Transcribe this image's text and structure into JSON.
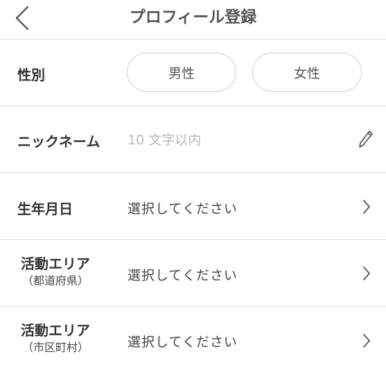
{
  "header": {
    "title": "プロフィール登録",
    "back_icon": "chevron-left-icon"
  },
  "gender": {
    "label": "性別",
    "options": [
      "男性",
      "女性"
    ]
  },
  "nickname": {
    "label": "ニックネーム",
    "placeholder": "10 文字以内",
    "value": "",
    "edit_icon": "pencil-icon"
  },
  "birthday": {
    "label": "生年月日",
    "value": "選択してください"
  },
  "area_prefecture": {
    "label": "活動エリア",
    "sublabel": "（都道府県）",
    "value": "選択してください"
  },
  "area_city": {
    "label": "活動エリア",
    "sublabel": "（市区町村）",
    "value": "選択してください"
  },
  "colors": {
    "text": "#333333",
    "placeholder": "#b8b8b8",
    "divider": "#dedede",
    "button_border": "#cfcfcf"
  }
}
